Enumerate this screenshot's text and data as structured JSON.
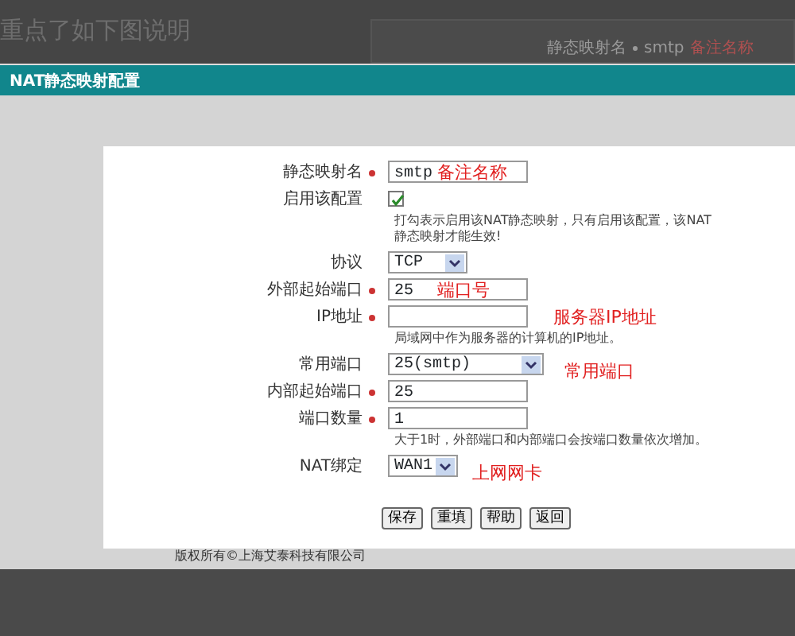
{
  "caption": "重点了如下图说明",
  "background_form": {
    "label": "静态映射名",
    "required": true,
    "value": "smtp",
    "note": "备注名称"
  },
  "dialog": {
    "title": "NAT静态映射配置"
  },
  "fields": [
    {
      "kind": "text",
      "label": "静态映射名",
      "required": true,
      "value": "smtp",
      "note": "备注名称"
    },
    {
      "kind": "checkbox",
      "label": "启用该配置",
      "checked": true,
      "hint": "打勾表示启用该NAT静态映射，只有启用该配置，该NAT静态映射才能生效!"
    },
    {
      "kind": "select",
      "label": "协议",
      "value": "TCP"
    },
    {
      "kind": "text",
      "label": "外部起始端口",
      "required": true,
      "value": "25",
      "note": "端口号"
    },
    {
      "kind": "text",
      "label": "IP地址",
      "required": true,
      "note": "服务器IP地址",
      "hint": "局域网中作为服务器的计算机的IP地址。"
    },
    {
      "kind": "wideselect",
      "label": "常用端口",
      "value": "25(smtp)",
      "note": "常用端口"
    },
    {
      "kind": "text",
      "label": "内部起始端口",
      "required": true,
      "value": "25"
    },
    {
      "kind": "text",
      "label": "端口数量",
      "required": true,
      "value": "1",
      "hint": "大于1时，外部端口和内部端口会按端口数量依次增加。"
    },
    {
      "kind": "smallselect",
      "label": "NAT绑定",
      "value": "WAN1",
      "note": "上网网卡"
    }
  ],
  "buttons": [
    "保存",
    "重填",
    "帮助",
    "返回"
  ],
  "footer": "版权所有©上海艾泰科技有限公司"
}
